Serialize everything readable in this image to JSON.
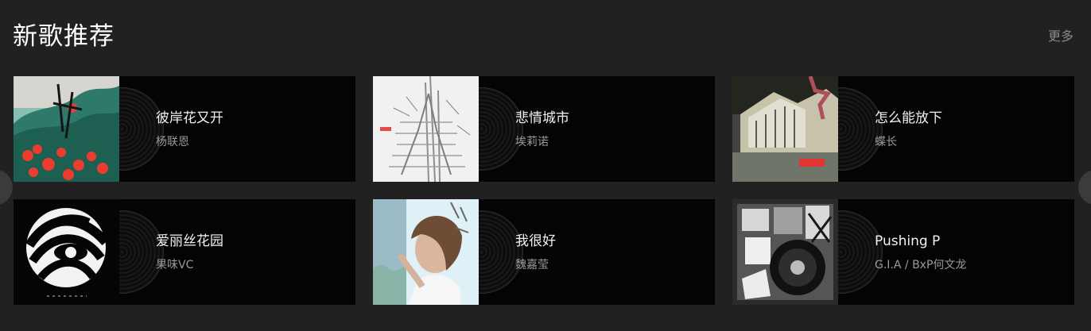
{
  "section": {
    "title": "新歌推荐",
    "more_label": "更多"
  },
  "songs": [
    {
      "name": "彼岸花又开",
      "artist": "杨联恩",
      "cover": "red-spider-lily-landscape-art"
    },
    {
      "name": "悲情城市",
      "artist": "埃莉诺",
      "cover": "grey-tower-sketch-art"
    },
    {
      "name": "怎么能放下",
      "artist": "蝶长",
      "cover": "night-house-photo-art"
    },
    {
      "name": "爱丽丝花园",
      "artist": "果味VC",
      "cover": "black-white-zebra-art"
    },
    {
      "name": "我很好",
      "artist": "魏嘉莹",
      "cover": "girl-portrait-art"
    },
    {
      "name": "Pushing P",
      "artist": "G.I.A / BxP何文龙",
      "cover": "record-collage-art"
    }
  ],
  "controls": {
    "previous_icon": "previous-arrow-icon",
    "next_icon": "next-arrow-icon"
  },
  "colors": {
    "background": "#222122",
    "card": "#050405",
    "title": "#ffffff",
    "song": "#f2f2f2",
    "artist": "#9a9a9a",
    "more": "#8a8a8a"
  }
}
